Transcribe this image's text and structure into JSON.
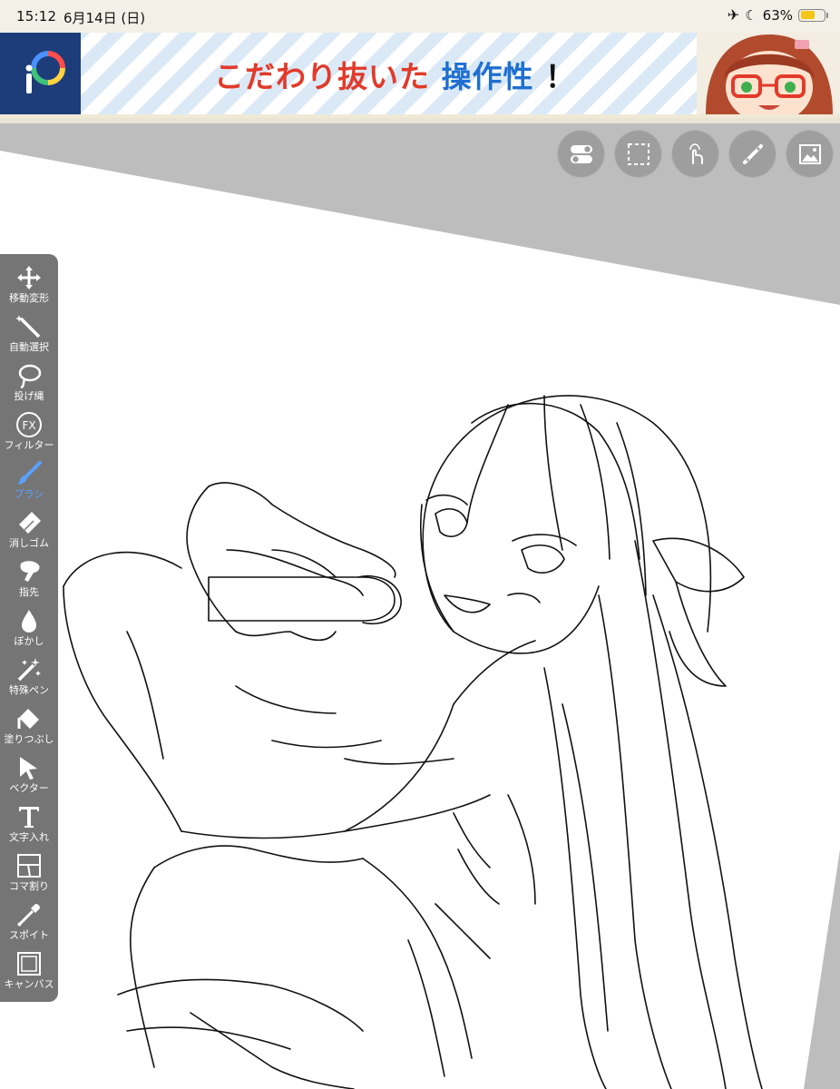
{
  "status_bar": {
    "time": "15:12",
    "date": "6月14日 (日)",
    "battery_percent": "63%",
    "battery_level": 0.63
  },
  "ad_banner": {
    "headline_part1": "こだわり抜いた",
    "headline_part2": "操作性",
    "headline_part3": "！",
    "logo_text": "iP"
  },
  "top_tools": [
    {
      "icon": "toggle-icon"
    },
    {
      "icon": "selection-icon"
    },
    {
      "icon": "touch-icon"
    },
    {
      "icon": "ruler-icon"
    },
    {
      "icon": "image-icon"
    }
  ],
  "palette": {
    "tools": [
      {
        "label": "移動変形",
        "icon": "move-icon"
      },
      {
        "label": "自動選択",
        "icon": "magic-wand-icon"
      },
      {
        "label": "投げ縄",
        "icon": "lasso-icon"
      },
      {
        "label": "フィルター",
        "icon": "fx-icon"
      },
      {
        "label": "ブラシ",
        "icon": "brush-icon"
      },
      {
        "label": "消しゴム",
        "icon": "eraser-icon"
      },
      {
        "label": "指先",
        "icon": "smudge-icon"
      },
      {
        "label": "ぼかし",
        "icon": "blur-icon"
      },
      {
        "label": "特殊ペン",
        "icon": "special-pen-icon"
      },
      {
        "label": "塗りつぶし",
        "icon": "fill-icon"
      },
      {
        "label": "ベクター",
        "icon": "vector-icon"
      },
      {
        "label": "文字入れ",
        "icon": "text-icon"
      },
      {
        "label": "コマ割り",
        "icon": "frame-divider-icon"
      },
      {
        "label": "スポイト",
        "icon": "eyedropper-icon"
      },
      {
        "label": "キャンバス",
        "icon": "canvas-icon"
      }
    ],
    "active": "ブラシ"
  },
  "colors": {
    "status_bg": "#f3f0e7",
    "canvas_bg": "#bdbdbd",
    "palette_bg": "#757575",
    "active_tool": "#5aa0ff",
    "ad_red": "#e23a2a",
    "ad_blue": "#1f6fd1"
  }
}
